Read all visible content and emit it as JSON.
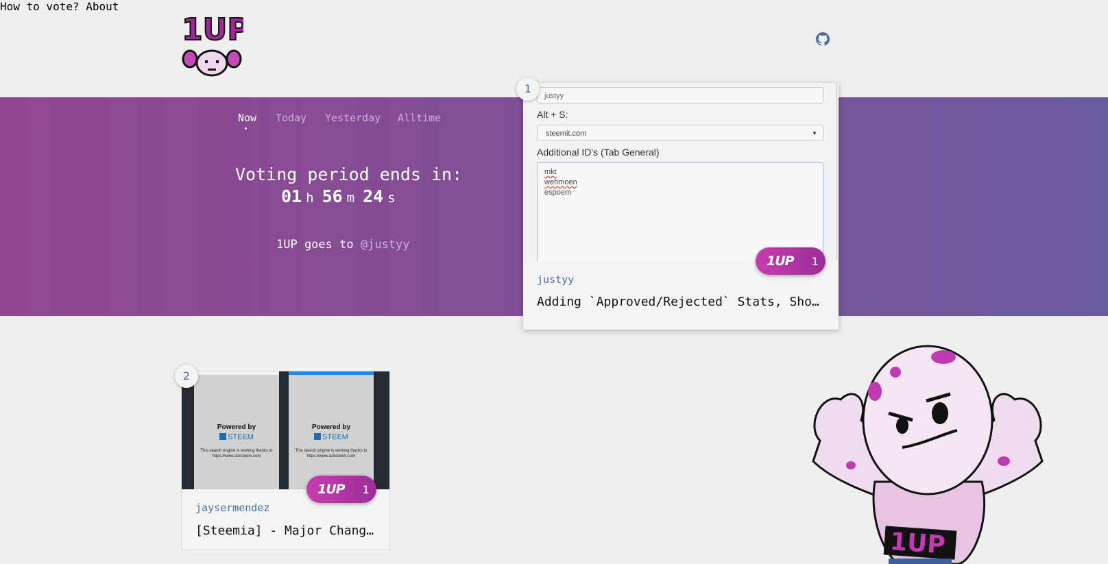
{
  "header": {
    "logo_text": "1UP",
    "nav": [
      {
        "label": "How to vote?"
      },
      {
        "label": "About"
      }
    ],
    "github_icon": "github-icon"
  },
  "hero": {
    "tabs": [
      {
        "label": "Now",
        "active": true
      },
      {
        "label": "Today",
        "active": false
      },
      {
        "label": "Yesterday",
        "active": false
      },
      {
        "label": "Alltime",
        "active": false
      }
    ],
    "voting_title": "Voting period ends in:",
    "countdown": {
      "hours": "01",
      "h_unit": "h",
      "minutes": "56",
      "m_unit": "m",
      "seconds": "24",
      "s_unit": "s"
    },
    "goes_to_prefix": "1UP goes to",
    "goes_to_user": "@justyy"
  },
  "posts": [
    {
      "rank": "1",
      "votes": "1",
      "vote_logo": "1UP",
      "author": "justyy",
      "title": "Adding `Approved/Rejected` Stats, Sho…",
      "screenshot": {
        "input_value": "justyy",
        "alt_label": "Alt + S:",
        "select_value": "steemit.com",
        "ids_label": "Additional ID's (Tab General)",
        "ids": [
          "mkt",
          "wehmoen",
          "espoem"
        ]
      }
    },
    {
      "rank": "2",
      "votes": "1",
      "vote_logo": "1UP",
      "author": "jaysermendez",
      "title": "[Steemia] - Major Changes",
      "screenshot": {
        "powered_by": "Powered by",
        "brand": "STEEM",
        "note": "This search engine is working thanks to https://www.asksteem.com"
      }
    }
  ],
  "colors": {
    "hero_start": "#91478f",
    "hero_end": "#6a5a9e",
    "link": "#4a6fa5",
    "vote_button": "#c83cb0"
  }
}
